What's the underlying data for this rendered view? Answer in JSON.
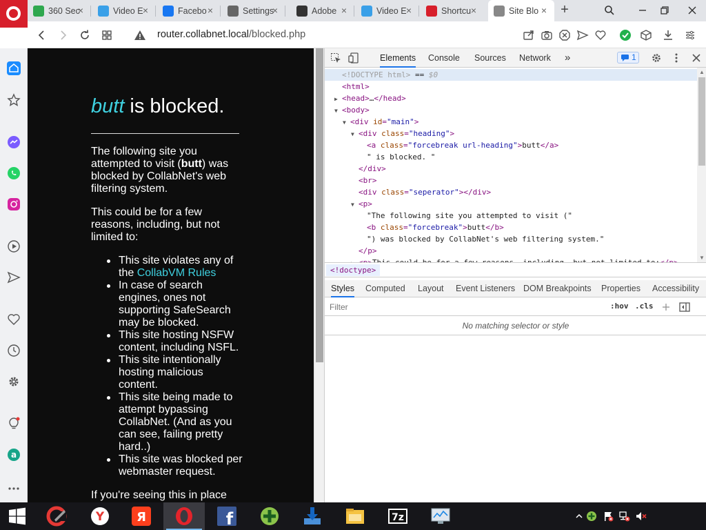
{
  "browser": {
    "tabs": [
      {
        "title": "360 Sec",
        "favicon": "shield-icon",
        "color": "#2fa84f"
      },
      {
        "title": "Video E",
        "favicon": "fish-icon",
        "color": "#3aa0e8"
      },
      {
        "title": "Facebo",
        "favicon": "facebook-icon",
        "color": "#1877f2"
      },
      {
        "title": "Settings",
        "favicon": "gear-icon",
        "color": "#666666"
      },
      {
        "title": "Adobe",
        "favicon": "archive-icon",
        "color": "#333333"
      },
      {
        "title": "Video E",
        "favicon": "fish-icon",
        "color": "#3aa0e8"
      },
      {
        "title": "Shortcu",
        "favicon": "opera-icon",
        "color": "#d71f2b"
      },
      {
        "title": "Site Blo",
        "favicon": "globe-icon",
        "color": "#888888",
        "active": true
      }
    ],
    "url_host": "router.collabnet.local",
    "url_path": "/blocked.php",
    "accent": "#d71f2b"
  },
  "page": {
    "blocked_word": "butt",
    "blocked_suffix": " is blocked.",
    "intro_1": "The following site you attempted to visit (",
    "intro_bold": "butt",
    "intro_2": ") was blocked by CollabNet's web filtering system.",
    "reasons_intro": "This could be for a few reasons, including, but not limited to:",
    "reasons": [
      {
        "text": "This site violates any of the ",
        "link": "CollabVM Rules"
      },
      {
        "text": "In case of search engines, ones not supporting SafeSearch may be blocked."
      },
      {
        "text": "This site hosting NSFW content, including NSFL."
      },
      {
        "text": "This site intentionally hosting malicious content."
      },
      {
        "text": "This site being made to attempt bypassing CollabNet. (And as you can see, failing pretty hard..)"
      },
      {
        "text": "This site was blocked per webmaster request."
      }
    ],
    "footer": "If you're seeing this in place",
    "link_color": "#3fd1e0"
  },
  "devtools": {
    "tabs": [
      "Elements",
      "Console",
      "Sources",
      "Network"
    ],
    "more": "»",
    "issues_count": "1",
    "dom_lines": [
      {
        "indent": 0,
        "html": "<span class='cm'>&lt;!DOCTYPE html&gt;</span> <span class='txt'>== </span><span class='cm' style='font-style:italic'>$0</span>",
        "selected": true
      },
      {
        "indent": 0,
        "html": "<span class='tag'>&lt;html&gt;</span>"
      },
      {
        "indent": 0,
        "tri": "▶",
        "html": "<span class='tag'>&lt;head&gt;</span><span class='txt'>…</span><span class='tag'>&lt;/head&gt;</span>"
      },
      {
        "indent": 0,
        "tri": "▼",
        "html": "<span class='tag'>&lt;body&gt;</span>"
      },
      {
        "indent": 1,
        "tri": "▼",
        "html": "<span class='tag'>&lt;div </span><span class='attr'>id</span><span class='tag'>=</span><span class='val'>\"main\"</span><span class='tag'>&gt;</span>"
      },
      {
        "indent": 2,
        "tri": "▼",
        "html": "<span class='tag'>&lt;div </span><span class='attr'>class</span><span class='tag'>=</span><span class='val'>\"heading\"</span><span class='tag'>&gt;</span>"
      },
      {
        "indent": 3,
        "html": "<span class='tag'>&lt;a </span><span class='attr'>class</span><span class='tag'>=</span><span class='val'>\"forcebreak url-heading\"</span><span class='tag'>&gt;</span><span class='txt'>butt</span><span class='tag'>&lt;/a&gt;</span>"
      },
      {
        "indent": 3,
        "html": "<span class='txt'>\" is blocked. \"</span>"
      },
      {
        "indent": 2,
        "html": "<span class='tag'>&lt;/div&gt;</span>"
      },
      {
        "indent": 2,
        "html": "<span class='tag'>&lt;br&gt;</span>"
      },
      {
        "indent": 2,
        "html": "<span class='tag'>&lt;div </span><span class='attr'>class</span><span class='tag'>=</span><span class='val'>\"seperator\"</span><span class='tag'>&gt;&lt;/div&gt;</span>"
      },
      {
        "indent": 2,
        "tri": "▼",
        "html": "<span class='tag'>&lt;p&gt;</span>"
      },
      {
        "indent": 3,
        "html": "<span class='txt'>\"The following site you attempted to visit (\"</span>"
      },
      {
        "indent": 3,
        "html": "<span class='tag'>&lt;b </span><span class='attr'>class</span><span class='tag'>=</span><span class='val'>\"forcebreak\"</span><span class='tag'>&gt;</span><span class='txt'>butt</span><span class='tag'>&lt;/b&gt;</span>"
      },
      {
        "indent": 3,
        "html": "<span class='txt'>\") was blocked by CollabNet's web filtering system.\"</span>"
      },
      {
        "indent": 2,
        "html": "<span class='tag'>&lt;/p&gt;</span>"
      },
      {
        "indent": 2,
        "tri": "▶",
        "html": "<span class='tag'>&lt;p&gt;</span><span class='txt'>This could be for a few reasons, including, but not limited to:</span><span class='tag'>&lt;/p&gt;</span>"
      }
    ],
    "breadcrumb": "<!doctype>",
    "style_tabs": [
      "Styles",
      "Computed",
      "Layout",
      "Event Listeners",
      "DOM Breakpoints",
      "Properties",
      "Accessibility"
    ],
    "filter_placeholder": "Filter",
    "hov": ":hov",
    "cls": ".cls",
    "no_match": "No matching selector or style"
  },
  "taskbar": {
    "apps": [
      "ccleaner-icon",
      "yandex-browser-icon",
      "yandex-icon",
      "opera-icon",
      "facebook-icon",
      "plus-icon",
      "download-icon",
      "file-explorer-icon",
      "7zip-icon",
      "monitor-icon"
    ]
  }
}
